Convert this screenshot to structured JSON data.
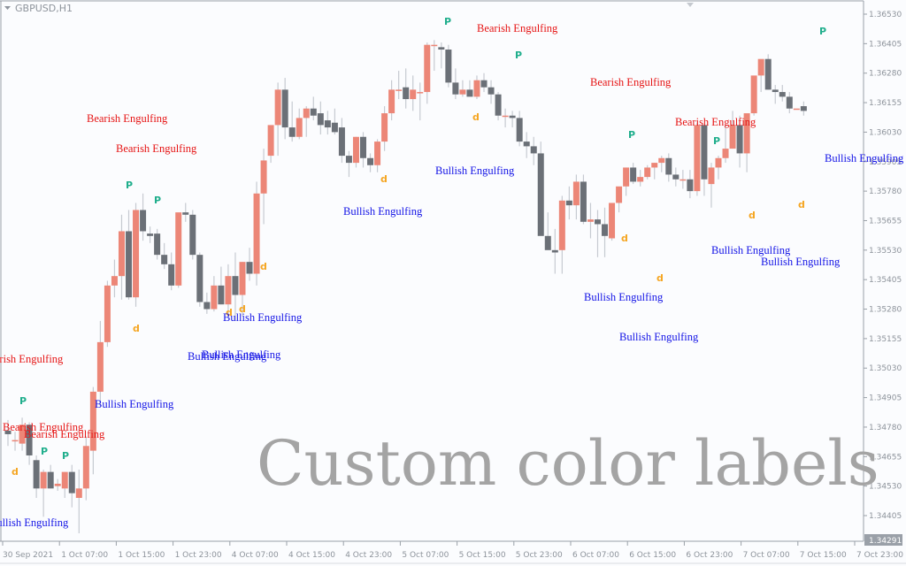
{
  "window": {
    "symbol_title": "GBPUSD,H1"
  },
  "watermark": "Custom color labels",
  "colors": {
    "bull_candle": "#ec8677",
    "bear_candle": "#6b7077",
    "wick": "#c6cad1",
    "bullish_label": "#1414e6",
    "bearish_label": "#e61414",
    "bullish_marker": "#f5a623",
    "bearish_marker": "#1fae8c",
    "axis": "#9aa0a8",
    "price_tag_bg": "#9aa0a8"
  },
  "chart_data": {
    "type": "candlestick",
    "title": "GBPUSD,H1",
    "ylim": [
      1.3426,
      1.3659
    ],
    "yticks": [
      "1.36530",
      "1.36405",
      "1.36280",
      "1.36155",
      "1.36030",
      "1.35905",
      "1.35780",
      "1.35655",
      "1.35530",
      "1.35405",
      "1.35280",
      "1.35155",
      "1.35030",
      "1.34905",
      "1.34780",
      "1.34655",
      "1.34530",
      "1.34405"
    ],
    "current_price": "1.34291",
    "xticks": [
      "30 Sep 2021",
      "1 Oct 07:00",
      "1 Oct 15:00",
      "1 Oct 23:00",
      "4 Oct 07:00",
      "4 Oct 15:00",
      "4 Oct 23:00",
      "5 Oct 07:00",
      "5 Oct 15:00",
      "5 Oct 23:00",
      "6 Oct 07:00",
      "6 Oct 15:00",
      "6 Oct 23:00",
      "7 Oct 07:00",
      "7 Oct 15:00",
      "7 Oct 23:00"
    ],
    "candles": [
      [
        1.34765,
        1.3481,
        1.347,
        1.3475
      ],
      [
        1.34725,
        1.3476,
        1.3468,
        1.34725
      ],
      [
        1.3471,
        1.3482,
        1.3468,
        1.3479
      ],
      [
        1.3479,
        1.348,
        1.3462,
        1.3466
      ],
      [
        1.3464,
        1.3466,
        1.3448,
        1.3452
      ],
      [
        1.3452,
        1.346,
        1.344,
        1.3459
      ],
      [
        1.3459,
        1.3462,
        1.3452,
        1.3452
      ],
      [
        1.3453,
        1.3456,
        1.3451,
        1.3454
      ],
      [
        1.3452,
        1.3459,
        1.3448,
        1.3459
      ],
      [
        1.3459,
        1.3462,
        1.3444,
        1.345
      ],
      [
        1.3448,
        1.346,
        1.3433,
        1.3452
      ],
      [
        1.3452,
        1.3474,
        1.3447,
        1.347
      ],
      [
        1.3468,
        1.3495,
        1.3458,
        1.3493
      ],
      [
        1.3493,
        1.3523,
        1.3487,
        1.3514
      ],
      [
        1.3514,
        1.354,
        1.3512,
        1.3538
      ],
      [
        1.3538,
        1.3549,
        1.3533,
        1.3542
      ],
      [
        1.3542,
        1.3568,
        1.3532,
        1.3561
      ],
      [
        1.3561,
        1.357,
        1.3532,
        1.3533
      ],
      [
        1.3533,
        1.3573,
        1.3529,
        1.357
      ],
      [
        1.357,
        1.3577,
        1.3557,
        1.3561
      ],
      [
        1.356,
        1.3563,
        1.3556,
        1.3559
      ],
      [
        1.356,
        1.3562,
        1.3549,
        1.3551
      ],
      [
        1.3551,
        1.3556,
        1.3545,
        1.3547
      ],
      [
        1.3547,
        1.3552,
        1.3536,
        1.3538
      ],
      [
        1.3538,
        1.3564,
        1.3537,
        1.3569
      ],
      [
        1.3569,
        1.3573,
        1.3565,
        1.3568
      ],
      [
        1.3568,
        1.357,
        1.3549,
        1.3551
      ],
      [
        1.3551,
        1.3552,
        1.3529,
        1.3531
      ],
      [
        1.3531,
        1.3535,
        1.3526,
        1.3528
      ],
      [
        1.3528,
        1.3542,
        1.3527,
        1.3538
      ],
      [
        1.3538,
        1.3546,
        1.353,
        1.353
      ],
      [
        1.353,
        1.3547,
        1.3526,
        1.3542
      ],
      [
        1.3542,
        1.3552,
        1.3523,
        1.3534
      ],
      [
        1.3534,
        1.3548,
        1.3525,
        1.3548
      ],
      [
        1.3548,
        1.3554,
        1.354,
        1.3543
      ],
      [
        1.3543,
        1.3582,
        1.3538,
        1.3577
      ],
      [
        1.3577,
        1.3596,
        1.3564,
        1.3591
      ],
      [
        1.3593,
        1.3602,
        1.359,
        1.3606
      ],
      [
        1.3606,
        1.3624,
        1.3593,
        1.3621
      ],
      [
        1.3621,
        1.3626,
        1.36,
        1.3605
      ],
      [
        1.3605,
        1.3616,
        1.3599,
        1.3601
      ],
      [
        1.3601,
        1.3613,
        1.36,
        1.3609
      ],
      [
        1.3609,
        1.3614,
        1.3601,
        1.3613
      ],
      [
        1.3613,
        1.3618,
        1.3608,
        1.361
      ],
      [
        1.3611,
        1.3616,
        1.3602,
        1.3606
      ],
      [
        1.3608,
        1.3612,
        1.3602,
        1.3605
      ],
      [
        1.3607,
        1.3613,
        1.3602,
        1.3603
      ],
      [
        1.3605,
        1.3609,
        1.359,
        1.3593
      ],
      [
        1.3593,
        1.3595,
        1.3584,
        1.359
      ],
      [
        1.359,
        1.3601,
        1.3588,
        1.3601
      ],
      [
        1.3601,
        1.3603,
        1.3588,
        1.3592
      ],
      [
        1.3592,
        1.3594,
        1.3586,
        1.3589
      ],
      [
        1.3589,
        1.36,
        1.3586,
        1.3599
      ],
      [
        1.3599,
        1.3614,
        1.3595,
        1.3611
      ],
      [
        1.3611,
        1.3625,
        1.3608,
        1.3621
      ],
      [
        1.3621,
        1.3629,
        1.3617,
        1.3621
      ],
      [
        1.3622,
        1.363,
        1.3613,
        1.3617
      ],
      [
        1.3617,
        1.3627,
        1.3612,
        1.3621
      ],
      [
        1.362,
        1.3624,
        1.3608,
        1.362
      ],
      [
        1.362,
        1.3641,
        1.3615,
        1.364
      ],
      [
        1.364,
        1.3642,
        1.3629,
        1.364
      ],
      [
        1.3639,
        1.3641,
        1.363,
        1.3638
      ],
      [
        1.3638,
        1.364,
        1.3622,
        1.3624
      ],
      [
        1.3624,
        1.363,
        1.3617,
        1.3619
      ],
      [
        1.3619,
        1.3625,
        1.3618,
        1.3621
      ],
      [
        1.3621,
        1.3625,
        1.3619,
        1.3618
      ],
      [
        1.3618,
        1.3627,
        1.3617,
        1.3625
      ],
      [
        1.3625,
        1.3628,
        1.362,
        1.3622
      ],
      [
        1.3622,
        1.3625,
        1.3615,
        1.3619
      ],
      [
        1.3619,
        1.362,
        1.3608,
        1.361
      ],
      [
        1.361,
        1.3613,
        1.3605,
        1.361
      ],
      [
        1.361,
        1.3612,
        1.3605,
        1.3609
      ],
      [
        1.3609,
        1.3612,
        1.3597,
        1.3599
      ],
      [
        1.3599,
        1.3603,
        1.3592,
        1.3597
      ],
      [
        1.3597,
        1.3601,
        1.3589,
        1.3594
      ],
      [
        1.3594,
        1.3599,
        1.3584,
        1.3559
      ],
      [
        1.3559,
        1.3569,
        1.3555,
        1.3553
      ],
      [
        1.3553,
        1.3562,
        1.3543,
        1.3552
      ],
      [
        1.3553,
        1.3576,
        1.3543,
        1.3574
      ],
      [
        1.3574,
        1.358,
        1.3566,
        1.3572
      ],
      [
        1.3572,
        1.3585,
        1.3566,
        1.3582
      ],
      [
        1.3582,
        1.3585,
        1.3564,
        1.3565
      ],
      [
        1.3565,
        1.3573,
        1.3558,
        1.3566
      ],
      [
        1.3566,
        1.357,
        1.355,
        1.3564
      ],
      [
        1.3564,
        1.3571,
        1.355,
        1.3559
      ],
      [
        1.3558,
        1.3572,
        1.3557,
        1.3573
      ],
      [
        1.3573,
        1.3579,
        1.3569,
        1.358
      ],
      [
        1.358,
        1.3588,
        1.3576,
        1.3588
      ],
      [
        1.3588,
        1.359,
        1.3581,
        1.3582
      ],
      [
        1.3582,
        1.3587,
        1.358,
        1.3584
      ],
      [
        1.3584,
        1.3589,
        1.3583,
        1.3588
      ],
      [
        1.3588,
        1.359,
        1.3583,
        1.359
      ],
      [
        1.359,
        1.3593,
        1.3586,
        1.3592
      ],
      [
        1.3592,
        1.3594,
        1.3582,
        1.3585
      ],
      [
        1.3585,
        1.3588,
        1.358,
        1.3583
      ],
      [
        1.3583,
        1.3587,
        1.3579,
        1.3583
      ],
      [
        1.3583,
        1.3587,
        1.3575,
        1.3578
      ],
      [
        1.3578,
        1.3607,
        1.3576,
        1.3606
      ],
      [
        1.3606,
        1.3606,
        1.3576,
        1.3583
      ],
      [
        1.3581,
        1.359,
        1.3571,
        1.3588
      ],
      [
        1.3588,
        1.3593,
        1.3583,
        1.3592
      ],
      [
        1.3592,
        1.3606,
        1.359,
        1.3596
      ],
      [
        1.3596,
        1.3612,
        1.3596,
        1.3606
      ],
      [
        1.3606,
        1.361,
        1.3588,
        1.3594
      ],
      [
        1.3594,
        1.361,
        1.3586,
        1.3611
      ],
      [
        1.3611,
        1.3626,
        1.361,
        1.3627
      ],
      [
        1.3627,
        1.3633,
        1.362,
        1.3634
      ],
      [
        1.3634,
        1.3636,
        1.3621,
        1.3621
      ],
      [
        1.3621,
        1.3623,
        1.3615,
        1.362
      ],
      [
        1.362,
        1.3623,
        1.3616,
        1.3618
      ],
      [
        1.3618,
        1.362,
        1.3611,
        1.3613
      ],
      [
        1.3613,
        1.3613,
        1.3613,
        1.3613
      ],
      [
        1.3614,
        1.3616,
        1.361,
        1.3612
      ]
    ],
    "annotations": [
      {
        "text": "Bearish Engulfing",
        "type": "bearish",
        "x": -20,
        "y": 406
      },
      {
        "text": "Bearish Engulfing",
        "type": "bearish",
        "x": 3,
        "y": 483
      },
      {
        "text": "Bearish Engulfing",
        "type": "bearish",
        "x": 27,
        "y": 491
      },
      {
        "text": "Bullish Engulfing",
        "type": "bullish",
        "x": -12,
        "y": 591
      },
      {
        "text": "Bullish Engulfing",
        "type": "bullish",
        "x": 107,
        "y": 457
      },
      {
        "text": "Bearish Engulfing",
        "type": "bearish",
        "x": 98,
        "y": 134
      },
      {
        "text": "Bearish Engulfing",
        "type": "bearish",
        "x": 131,
        "y": 168
      },
      {
        "text": "Bullish Engulfing",
        "type": "bullish",
        "x": 252,
        "y": 359
      },
      {
        "text": "Bullish Engulfing",
        "type": "bullish",
        "x": 212,
        "y": 403
      },
      {
        "text": "Bullish Engulfing",
        "type": "bullish",
        "x": 228,
        "y": 401
      },
      {
        "text": "Bullish Engulfing",
        "type": "bullish",
        "x": 388,
        "y": 239
      },
      {
        "text": "Bullish Engulfing",
        "type": "bullish",
        "x": 492,
        "y": 193
      },
      {
        "text": "Bearish Engulfing",
        "type": "bearish",
        "x": 539,
        "y": 32
      },
      {
        "text": "Bearish Engulfing",
        "type": "bearish",
        "x": 667,
        "y": 93
      },
      {
        "text": "Bearish Engulfing",
        "type": "bearish",
        "x": 763,
        "y": 138
      },
      {
        "text": "Bullish Engulfing",
        "type": "bullish",
        "x": 660,
        "y": 336
      },
      {
        "text": "Bullish Engulfing",
        "type": "bullish",
        "x": 700,
        "y": 381
      },
      {
        "text": "Bullish Engulfing",
        "type": "bullish",
        "x": 804,
        "y": 283
      },
      {
        "text": "Bullish Engulfing",
        "type": "bullish",
        "x": 860,
        "y": 296
      },
      {
        "text": "Bullish Engulfing",
        "type": "bullish",
        "x": 932,
        "y": 179
      }
    ],
    "markers": [
      {
        "type": "bearish",
        "x": 25,
        "y": 452
      },
      {
        "type": "bearish",
        "x": 49,
        "y": 509
      },
      {
        "type": "bearish",
        "x": 73,
        "y": 514
      },
      {
        "type": "bullish",
        "x": 16,
        "y": 532
      },
      {
        "type": "bearish",
        "x": 145,
        "y": 208
      },
      {
        "type": "bearish",
        "x": 177,
        "y": 225
      },
      {
        "type": "bullish",
        "x": 153,
        "y": 370
      },
      {
        "type": "bullish",
        "x": 297,
        "y": 300
      },
      {
        "type": "bullish",
        "x": 273,
        "y": 348
      },
      {
        "type": "bullish",
        "x": 258,
        "y": 352
      },
      {
        "type": "bullish",
        "x": 433,
        "y": 201
      },
      {
        "type": "bullish",
        "x": 537,
        "y": 131
      },
      {
        "type": "bearish",
        "x": 505,
        "y": 23
      },
      {
        "type": "bearish",
        "x": 585,
        "y": 61
      },
      {
        "type": "bearish",
        "x": 713,
        "y": 151
      },
      {
        "type": "bearish",
        "x": 809,
        "y": 158
      },
      {
        "type": "bearish",
        "x": 929,
        "y": 34
      },
      {
        "type": "bullish",
        "x": 705,
        "y": 268
      },
      {
        "type": "bullish",
        "x": 745,
        "y": 313
      },
      {
        "type": "bullish",
        "x": 849,
        "y": 242
      },
      {
        "type": "bullish",
        "x": 905,
        "y": 230
      }
    ]
  }
}
